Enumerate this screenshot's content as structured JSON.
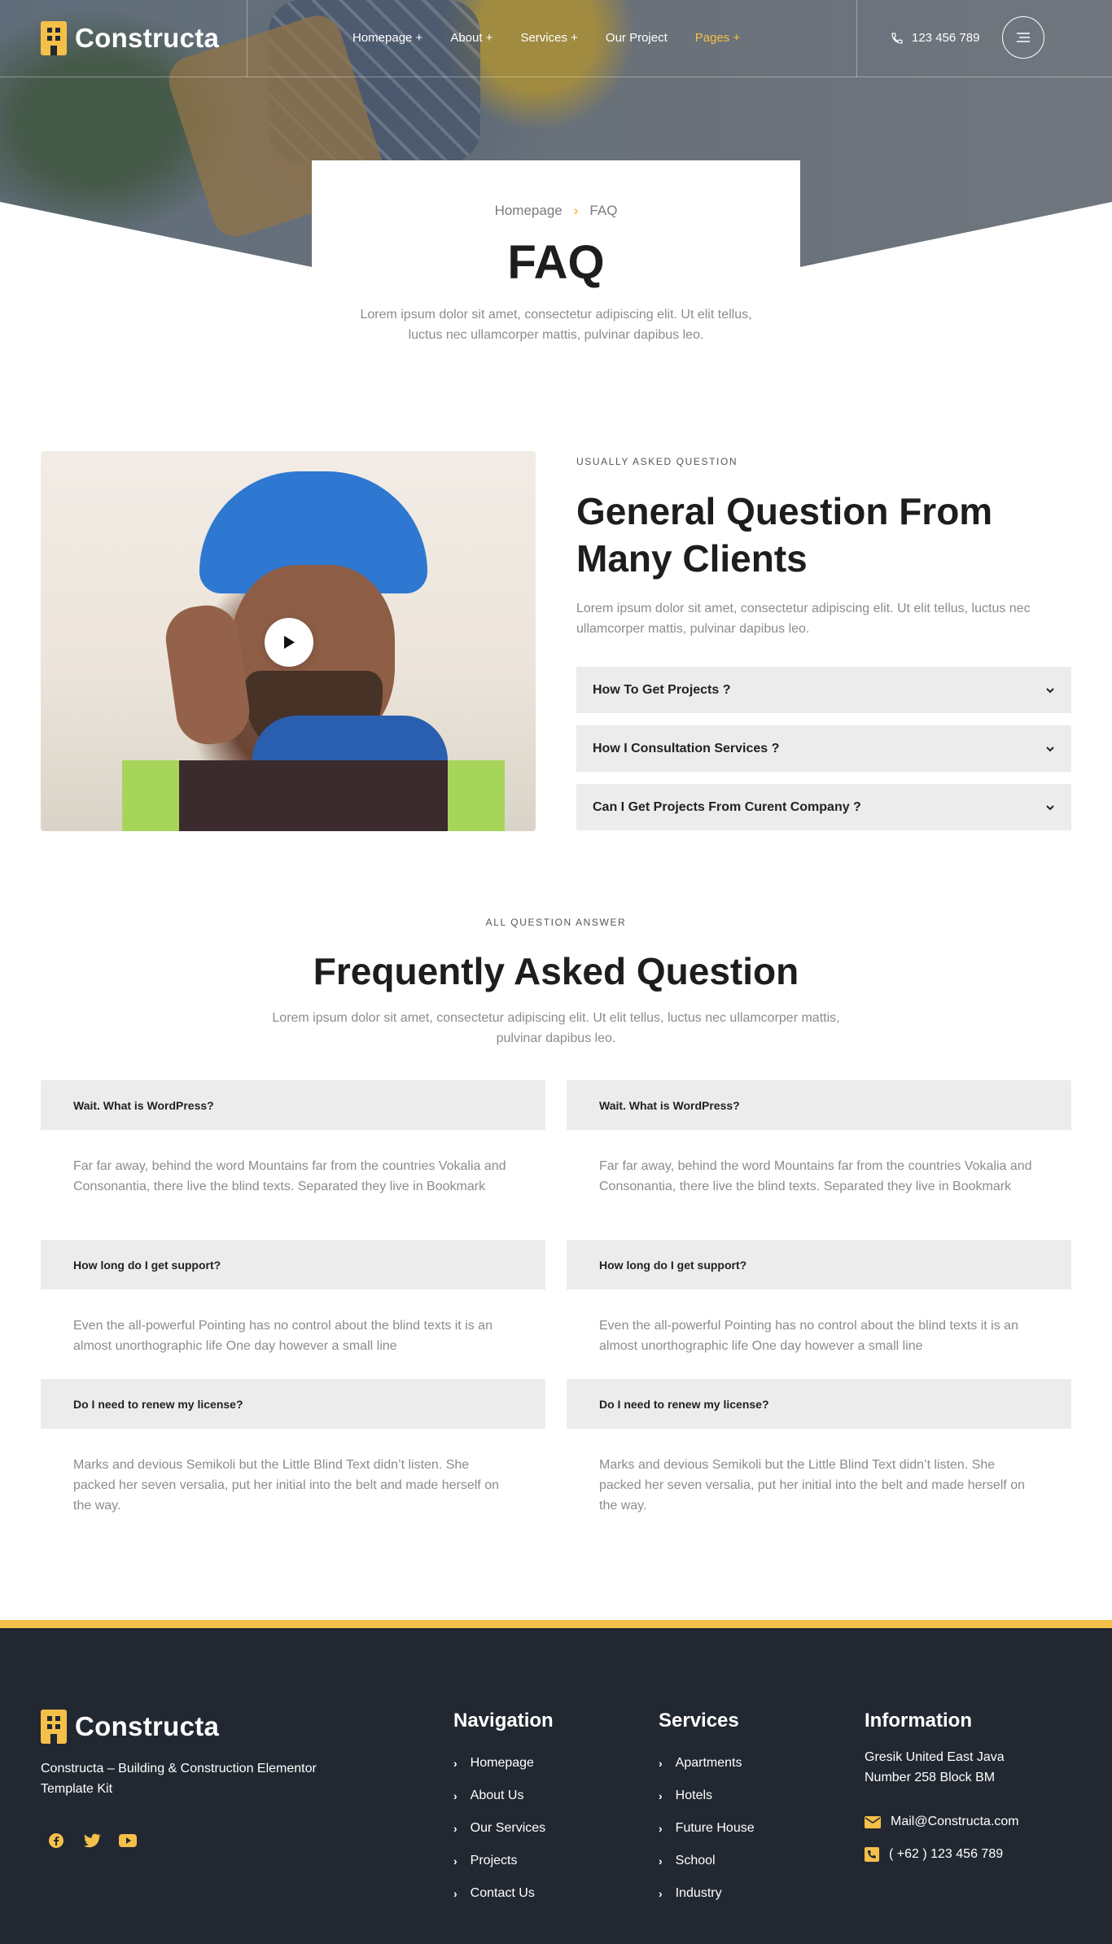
{
  "header": {
    "brand": "Constructa",
    "nav": [
      {
        "label": "Homepage +",
        "active": false
      },
      {
        "label": "About +",
        "active": false
      },
      {
        "label": "Services +",
        "active": false
      },
      {
        "label": "Our Project",
        "active": false
      },
      {
        "label": "Pages +",
        "active": true
      }
    ],
    "phone": "123 456 789",
    "accent_color": "#f5c04a"
  },
  "page_title": {
    "breadcrumb": [
      "Homepage",
      "FAQ"
    ],
    "title": "FAQ",
    "intro": "Lorem ipsum dolor sit amet, consectetur adipiscing elit. Ut elit tellus, luctus nec ullamcorper mattis, pulvinar dapibus leo."
  },
  "general": {
    "eyebrow": "USUALLY ASKED QUESTION",
    "title": "General Question From Many Clients",
    "text": "Lorem ipsum dolor sit amet, consectetur adipiscing elit. Ut elit tellus, luctus nec ullamcorper mattis, pulvinar dapibus leo.",
    "accordion": [
      "How To Get Projects ?",
      "How I Consultation Services ?",
      "Can I Get Projects From Curent Company ?"
    ]
  },
  "faq": {
    "eyebrow": "ALL QUESTION ANSWER",
    "title": "Frequently Asked Question",
    "intro": "Lorem ipsum dolor sit amet, consectetur adipiscing elit. Ut elit tellus, luctus nec ullamcorper mattis, pulvinar dapibus leo.",
    "left": [
      {
        "q": "Wait. What is WordPress?",
        "a": "Far far away, behind the word Mountains far from the countries Vokalia and Consonantia, there live the blind texts. Separated they live in Bookmark"
      },
      {
        "q": "How long do I get support?",
        "a": "Even the all-powerful Pointing has no control about the blind texts it is an almost unorthographic life One day however a small line"
      },
      {
        "q": "Do I need to renew my license?",
        "a": "Marks and devious Semikoli but the Little Blind Text didn’t listen. She packed her seven versalia, put her initial into the belt and made herself on the way."
      }
    ],
    "right": [
      {
        "q": "Wait. What is WordPress?",
        "a": "Far far away, behind the word Mountains far from the countries Vokalia and Consonantia, there live the blind texts. Separated they live in Bookmark"
      },
      {
        "q": "How long do I get support?",
        "a": "Even the all-powerful Pointing has no control about the blind texts it is an almost unorthographic life One day however a small line"
      },
      {
        "q": "Do I need to renew my license?",
        "a": "Marks and devious Semikoli but the Little Blind Text didn’t listen. She packed her seven versalia, put her initial into the belt and made herself on the way."
      }
    ]
  },
  "footer": {
    "brand": "Constructa",
    "tagline": "Constructa – Building & Construction Elementor Template Kit",
    "socials": [
      "facebook-icon",
      "twitter-icon",
      "youtube-icon"
    ],
    "navigation": {
      "title": "Navigation",
      "items": [
        "Homepage",
        "About Us",
        "Our Services",
        "Projects",
        "Contact Us"
      ]
    },
    "services": {
      "title": "Services",
      "items": [
        "Apartments",
        "Hotels",
        "Future House",
        "School",
        "Industry"
      ]
    },
    "information": {
      "title": "Information",
      "address": "Gresik United East Java Number 258 Block BM",
      "email": "Mail@Constructa.com",
      "phone": "( +62 ) 123 456 789"
    },
    "bg_color": "#222831"
  }
}
